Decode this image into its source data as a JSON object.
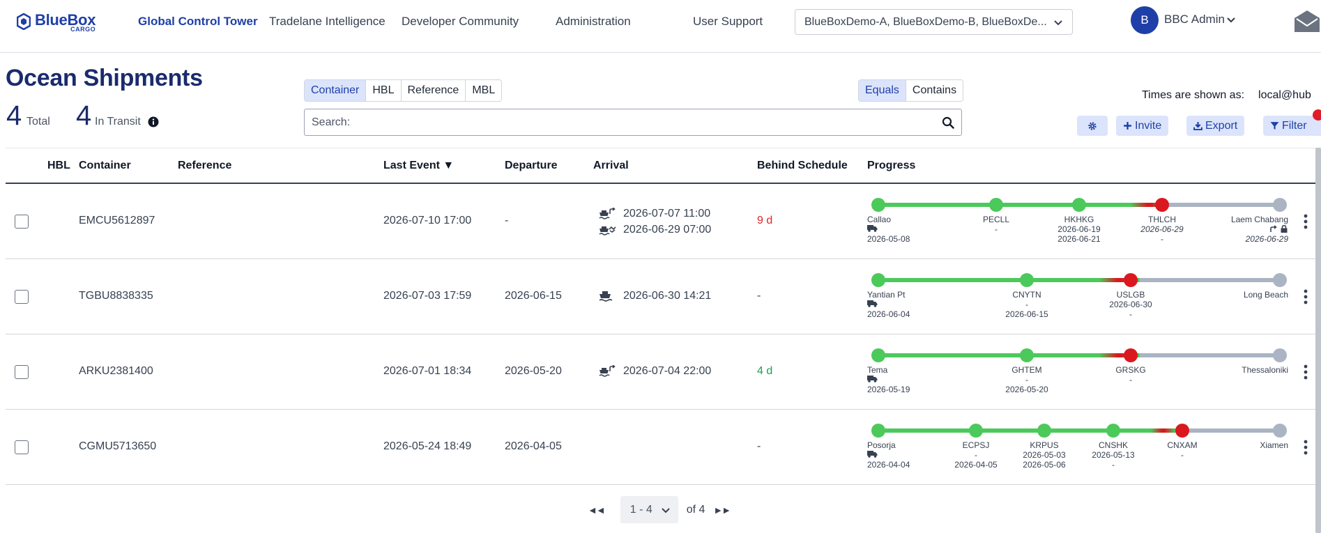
{
  "brand": {
    "name": "BlueBox",
    "sub": "CARGO",
    "color": "#1f3fa8"
  },
  "nav": [
    {
      "label": "Global Control Tower",
      "active": true
    },
    {
      "label": "Tradelane Intelligence"
    },
    {
      "label": "Developer Community"
    },
    {
      "label": "Administration"
    },
    {
      "label": "User Support"
    }
  ],
  "tenant_select": {
    "value": "BlueBoxDemo-A, BlueBoxDemo-B, BlueBoxDe..."
  },
  "user": {
    "initial": "B",
    "name": "BBC Admin"
  },
  "page": {
    "title": "Ocean Shipments",
    "total_count": "4",
    "total_label": "Total",
    "transit_count": "4",
    "transit_label": "In Transit"
  },
  "search": {
    "field_tabs": [
      "Container",
      "HBL",
      "Reference",
      "MBL"
    ],
    "field_active": "Container",
    "match_tabs": [
      "Equals",
      "Contains"
    ],
    "match_active": "Equals",
    "placeholder": "Search:"
  },
  "times": {
    "label": "Times are shown as:",
    "tz": "local@hub"
  },
  "actions": {
    "invite": "Invite",
    "export": "Export",
    "filter": "Filter"
  },
  "columns": {
    "hbl": "HBL",
    "container": "Container",
    "reference": "Reference",
    "last_event": "Last Event ▼",
    "departure": "Departure",
    "arrival": "Arrival",
    "behind": "Behind Schedule",
    "progress": "Progress"
  },
  "rows": [
    {
      "container": "EMCU5612897",
      "last_event": "2026-07-10 17:00",
      "departure": "-",
      "arrival": [
        {
          "icon": "ship-redirect-icon",
          "text": "2026-07-07 11:00"
        },
        {
          "icon": "ship-handshake-icon",
          "text": "2026-06-29 07:00"
        }
      ],
      "behind": "9 d",
      "behind_color": "#dc2626",
      "progress": {
        "completed_fraction": 0.72,
        "stops": [
          {
            "code": "Callao",
            "l1": "",
            "l2": "2026-05-08",
            "state": "done",
            "truck": true
          },
          {
            "code": "PECLL",
            "l1": "-",
            "l2": "",
            "state": "done"
          },
          {
            "code": "HKHKG",
            "l1": "2026-06-19",
            "l2": "2026-06-21",
            "state": "done"
          },
          {
            "code": "THLCH",
            "l1": "2026-06-29",
            "l2": "-",
            "state": "current",
            "italic": true
          },
          {
            "code": "Laem Chabang",
            "l1": "",
            "l2": "2026-06-29",
            "state": "pending",
            "italic2": true,
            "end_icons": true
          }
        ]
      }
    },
    {
      "container": "TGBU8838335",
      "last_event": "2026-07-03 17:59",
      "departure": "2026-06-15",
      "arrival": [
        {
          "icon": "ship-icon",
          "text": "2026-06-30 14:21"
        }
      ],
      "behind": "-",
      "behind_color": "#374151",
      "progress": {
        "completed_fraction": 0.65,
        "stops": [
          {
            "code": "Yantian Pt",
            "l1": "",
            "l2": "2026-06-04",
            "state": "done",
            "truck": true
          },
          {
            "code": "CNYTN",
            "l1": "-",
            "l2": "2026-06-15",
            "state": "done"
          },
          {
            "code": "USLGB",
            "l1": "2026-06-30",
            "l2": "-",
            "state": "current"
          },
          {
            "code": "Long Beach",
            "l1": "",
            "l2": "",
            "state": "pending"
          }
        ]
      }
    },
    {
      "container": "ARKU2381400",
      "last_event": "2026-07-01 18:34",
      "departure": "2026-05-20",
      "arrival": [
        {
          "icon": "ship-redirect-icon",
          "text": "2026-07-04 22:00"
        }
      ],
      "behind": "4 d",
      "behind_color": "#16a34a",
      "progress": {
        "completed_fraction": 0.65,
        "stops": [
          {
            "code": "Tema",
            "l1": "",
            "l2": "2026-05-19",
            "state": "done",
            "truck": true
          },
          {
            "code": "GHTEM",
            "l1": "-",
            "l2": "2026-05-20",
            "state": "done"
          },
          {
            "code": "GRSKG",
            "l1": "-",
            "l2": "",
            "state": "current"
          },
          {
            "code": "Thessaloniki",
            "l1": "",
            "l2": "",
            "state": "pending"
          }
        ]
      }
    },
    {
      "container": "CGMU5713650",
      "last_event": "2026-05-24 18:49",
      "departure": "2026-04-05",
      "arrival": [],
      "behind": "-",
      "behind_color": "#374151",
      "progress": {
        "completed_fraction": 0.74,
        "stops": [
          {
            "code": "Posorja",
            "l1": "",
            "l2": "2026-04-04",
            "state": "done",
            "truck": true
          },
          {
            "code": "ECPSJ",
            "l1": "-",
            "l2": "2026-04-05",
            "state": "done"
          },
          {
            "code": "KRPUS",
            "l1": "2026-05-03",
            "l2": "2026-05-06",
            "state": "done"
          },
          {
            "code": "CNSHK",
            "l1": "2026-05-13",
            "l2": "-",
            "state": "done"
          },
          {
            "code": "CNXAM",
            "l1": "-",
            "l2": "",
            "state": "current"
          },
          {
            "code": "Xiamen",
            "l1": "",
            "l2": "",
            "state": "pending"
          }
        ]
      }
    }
  ],
  "pagination": {
    "range": "1 - 4",
    "of": "of 4",
    "first": "◄◄",
    "last": "►►"
  },
  "colors": {
    "done": "#4cc95b",
    "current": "#d9191f",
    "pending": "#aab4c3",
    "accent_bg": "#dbe4fb"
  }
}
